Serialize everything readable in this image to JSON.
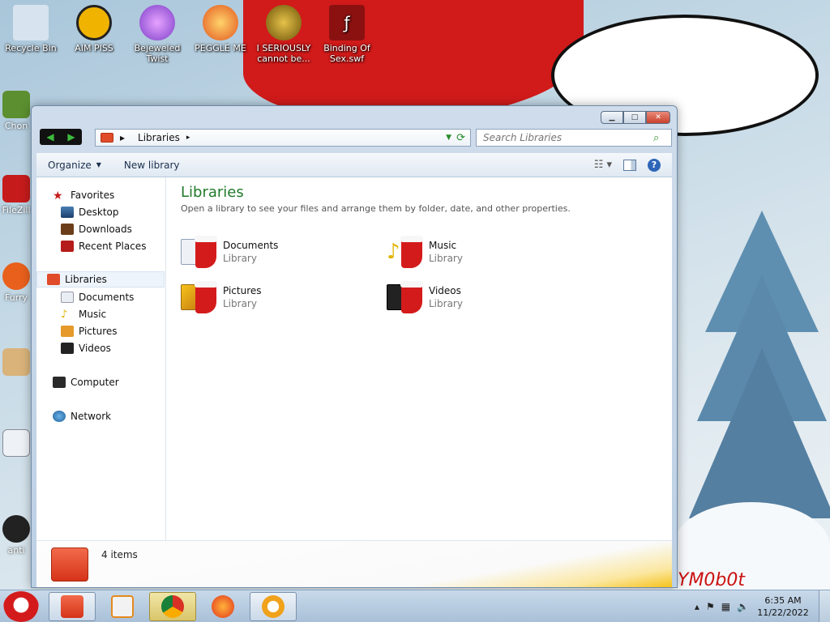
{
  "desktop": {
    "icons": [
      {
        "label": "Recycle Bin",
        "color": "#d7e3ee"
      },
      {
        "label": "AIM PISS",
        "color": "#f0b400"
      },
      {
        "label": "Bejeweled Twist",
        "color": "#7d3fc8"
      },
      {
        "label": "PEGGLE ME",
        "color": "#e2561f"
      },
      {
        "label": "I SERIOUSLY cannot be...",
        "color": "#c9a21a"
      },
      {
        "label": "Binding Of Sex.swf",
        "color": "#8b1111"
      }
    ],
    "partial_icons": [
      {
        "label": "Chon",
        "color": "#5b8f2f"
      },
      {
        "label": "FileZill",
        "color": "#c51b1b"
      },
      {
        "label": "Furry",
        "color": "#e8601c"
      },
      {
        "label": "",
        "color": "#d9b37a"
      },
      {
        "label": "",
        "color": "#eef2f6"
      },
      {
        "label": "anti",
        "color": "#222222"
      }
    ]
  },
  "window": {
    "address": {
      "crumb": "Libraries"
    },
    "search": {
      "placeholder": "Search Libraries"
    },
    "toolbar": {
      "organize": "Organize",
      "new_library": "New library"
    },
    "nav": {
      "favorites": "Favorites",
      "desktop": "Desktop",
      "downloads": "Downloads",
      "recent_places": "Recent Places",
      "libraries": "Libraries",
      "documents": "Documents",
      "music": "Music",
      "pictures": "Pictures",
      "videos": "Videos",
      "computer": "Computer",
      "network": "Network"
    },
    "content": {
      "title": "Libraries",
      "subtitle": "Open a library to see your files and arrange them by folder, date, and other properties.",
      "items": [
        {
          "name": "Documents",
          "kind": "Library"
        },
        {
          "name": "Music",
          "kind": "Library"
        },
        {
          "name": "Pictures",
          "kind": "Library"
        },
        {
          "name": "Videos",
          "kind": "Library"
        }
      ]
    },
    "details": {
      "count": "4 items"
    }
  },
  "taskbar": {
    "time": "6:35 AM",
    "date": "11/22/2022"
  },
  "colors": {
    "accent_green": "#1f7a2a",
    "stocking_red": "#d41b1b",
    "selection": "#eef4fb"
  }
}
